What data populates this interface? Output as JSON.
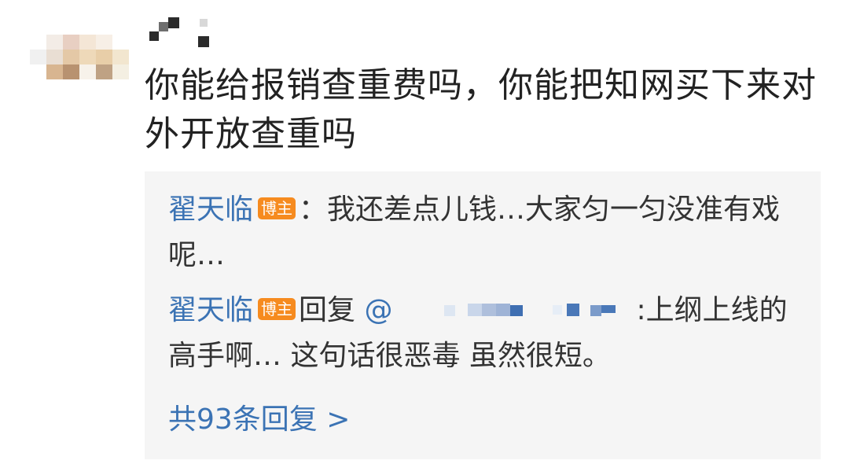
{
  "comment": {
    "avatar_label": "avatar (pixelated)",
    "text": "你能给报销查重费吗，你能把知网买下来对外开放查重吗"
  },
  "replies": [
    {
      "author": "翟天临",
      "badge": "博主",
      "separator": "：",
      "text": "我还差点儿钱…大家匀一匀没准有戏呢…"
    },
    {
      "author": "翟天临",
      "badge": "博主",
      "reply_word": "回复",
      "mention_prefix": "@",
      "after_mention": ":上纲上线的高手啊… 这句话很恶毒 虽然很短。"
    }
  ],
  "more_replies": "共93条回复 >",
  "colors": {
    "link": "#3b73b4",
    "badge": "#f68b1f",
    "reply_bg": "#f5f5f5",
    "text": "#222222"
  }
}
